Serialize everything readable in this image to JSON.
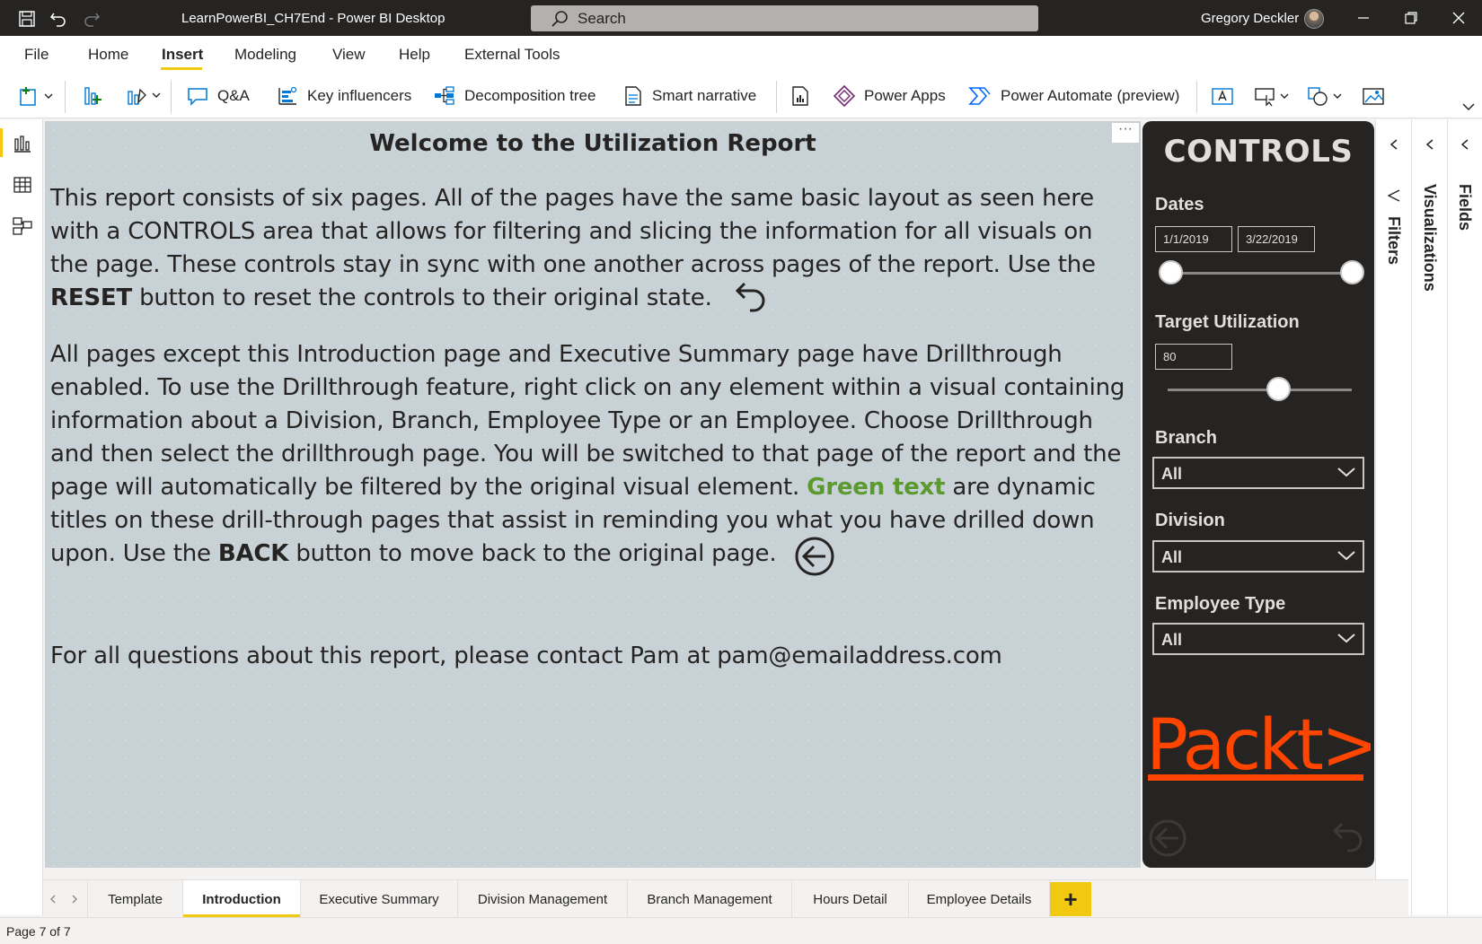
{
  "titlebar": {
    "app_title": "LearnPowerBI_CH7End - Power BI Desktop",
    "search_placeholder": "Search",
    "user_name": "Gregory Deckler"
  },
  "menu": {
    "items": [
      "File",
      "Home",
      "Insert",
      "Modeling",
      "View",
      "Help",
      "External Tools"
    ],
    "active": "Insert"
  },
  "ribbon": {
    "qa": "Q&A",
    "key_influencers": "Key influencers",
    "decomposition_tree": "Decomposition tree",
    "smart_narrative": "Smart narrative",
    "power_apps": "Power Apps",
    "power_automate": "Power Automate (preview)"
  },
  "report": {
    "title": "Welcome to the Utilization Report",
    "para1_a": "This report consists of six pages. All of the pages have the same basic layout as seen here with a CONTROLS area that allows for filtering and slicing the information for all visuals on the page. These controls stay in sync with one another across pages of the report. Use the ",
    "para1_bold": "RESET",
    "para1_b": " button to reset the controls to their original state.",
    "para2_a": "All pages except this Introduction page and Executive Summary page have Drillthrough enabled. To use the Drillthrough feature, right click on any element within a visual containing information about a Division, Branch, Employee Type or an Employee. Choose Drillthrough and then select the drillthrough page. You will be switched to that page of the report and the page will automatically be filtered by the original visual element. ",
    "para2_green": "Green text",
    "para2_b": " are dynamic titles on these drill-through pages that assist in reminding you what you have drilled down upon. Use the ",
    "para2_bold": "BACK",
    "para2_c": " button to move back to the original page.",
    "contact": "For all questions about this report, please contact Pam at pam@emailaddress.com",
    "more": "···"
  },
  "controls": {
    "title": "CONTROLS",
    "dates_label": "Dates",
    "date_start": "1/1/2019",
    "date_end": "3/22/2019",
    "target_label": "Target Utilization",
    "target_value": "80",
    "target_slider_fraction": 0.6,
    "branch_label": "Branch",
    "branch_value": "All",
    "division_label": "Division",
    "division_value": "All",
    "employee_type_label": "Employee Type",
    "employee_type_value": "All",
    "logo_text": "Packt>",
    "logo_color": "#ff4500"
  },
  "panes": {
    "filters": "Filters",
    "visualizations": "Visualizations",
    "fields": "Fields"
  },
  "tabs": {
    "items": [
      "Template",
      "Introduction",
      "Executive Summary",
      "Division Management",
      "Branch Management",
      "Hours Detail",
      "Employee Details"
    ],
    "active": "Introduction",
    "add": "+"
  },
  "status": {
    "page": "Page 7 of 7"
  },
  "colors": {
    "accent": "#f2c811",
    "canvas_bg": "#c8d1d6",
    "controls_bg": "#252423",
    "green_text": "#5a9a2e"
  }
}
